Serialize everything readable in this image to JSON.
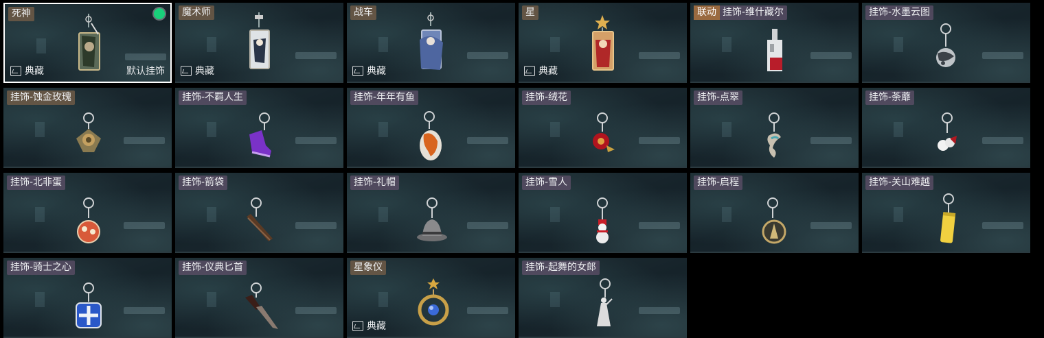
{
  "items": [
    {
      "name": "死神",
      "icon": "death-tarot-card-icon",
      "collection": "典藏",
      "default_label": "默认挂饰",
      "equipped": true
    },
    {
      "name": "魔术师",
      "icon": "magician-tarot-card-icon",
      "collection": "典藏"
    },
    {
      "name": "战车",
      "icon": "chariot-tarot-card-icon",
      "collection": "典藏"
    },
    {
      "name": "星",
      "icon": "star-tarot-card-icon",
      "collection": "典藏"
    },
    {
      "name": "挂饰-维什藏尔",
      "tag": "联动",
      "icon": "collab-keychain-icon"
    },
    {
      "name": "挂饰-水墨云图",
      "icon": "ink-cloud-orb-icon"
    },
    {
      "name": "挂饰-蚀金玫瑰",
      "icon": "gold-rose-icon"
    },
    {
      "name": "挂饰-不羁人生",
      "icon": "purple-sneaker-icon"
    },
    {
      "name": "挂饰-年年有鱼",
      "icon": "fish-icon"
    },
    {
      "name": "挂饰-绒花",
      "icon": "velvet-flower-icon"
    },
    {
      "name": "挂饰-点翠",
      "icon": "kingfisher-ornament-icon"
    },
    {
      "name": "挂饰-荼蘼",
      "icon": "white-flower-icon"
    },
    {
      "name": "挂饰-北非蛋",
      "icon": "shakshuka-pan-icon"
    },
    {
      "name": "挂饰-箭袋",
      "icon": "quiver-icon"
    },
    {
      "name": "挂饰-礼帽",
      "icon": "fedora-hat-icon"
    },
    {
      "name": "挂饰-雪人",
      "icon": "snowman-icon"
    },
    {
      "name": "挂饰-启程",
      "icon": "compass-medallion-icon"
    },
    {
      "name": "挂饰-关山难越",
      "icon": "yellow-scroll-icon"
    },
    {
      "name": "挂饰-骑士之心",
      "icon": "blue-cross-shield-icon"
    },
    {
      "name": "挂饰-仪典匕首",
      "icon": "ceremonial-dagger-icon"
    },
    {
      "name": "星象仪",
      "icon": "astrolabe-icon",
      "collection": "典藏"
    },
    {
      "name": "挂饰-起舞的女郎",
      "icon": "dancing-lady-figurine-icon"
    }
  ]
}
